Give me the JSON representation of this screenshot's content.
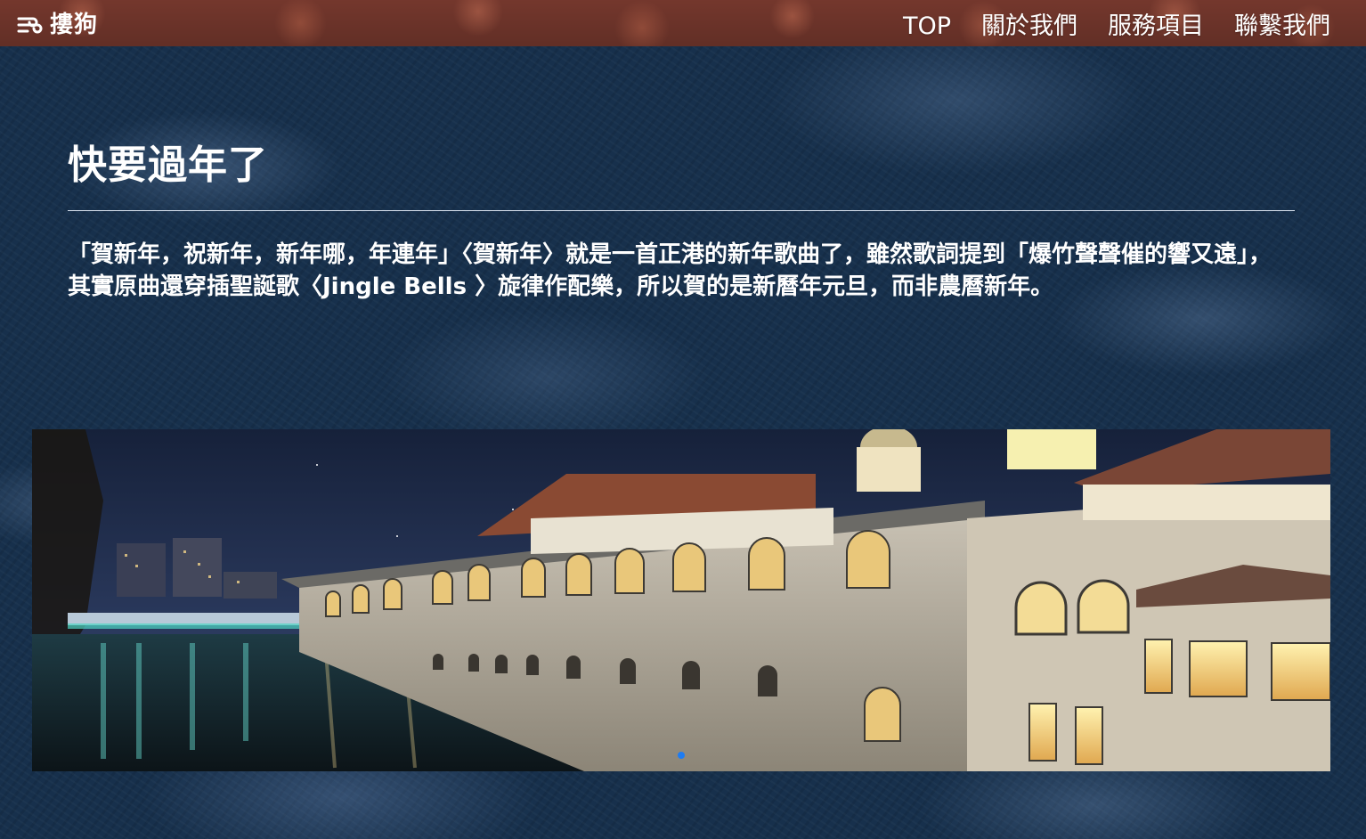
{
  "header": {
    "logo_text": "摟狗",
    "nav": [
      {
        "label": "TOP"
      },
      {
        "label": "關於我們"
      },
      {
        "label": "服務項目"
      },
      {
        "label": "聯繫我們"
      }
    ]
  },
  "main": {
    "title": "快要過年了",
    "intro": "「賀新年，祝新年，新年哪，年連年」〈賀新年〉就是一首正港的新年歌曲了，雖然歌詞提到「爆竹聲聲催的響又遠」，其實原曲還穿插聖誕歌〈Jingle Bells 〉旋律作配樂，所以賀的是新曆年元旦，而非農曆新年。"
  },
  "carousel": {
    "slide_count": 1,
    "active_index": 0,
    "active_dot_color": "#1e7cf2"
  },
  "colors": {
    "header_bg": "#7a3a2f",
    "page_bg": "#17304c",
    "text": "#ffffff"
  }
}
